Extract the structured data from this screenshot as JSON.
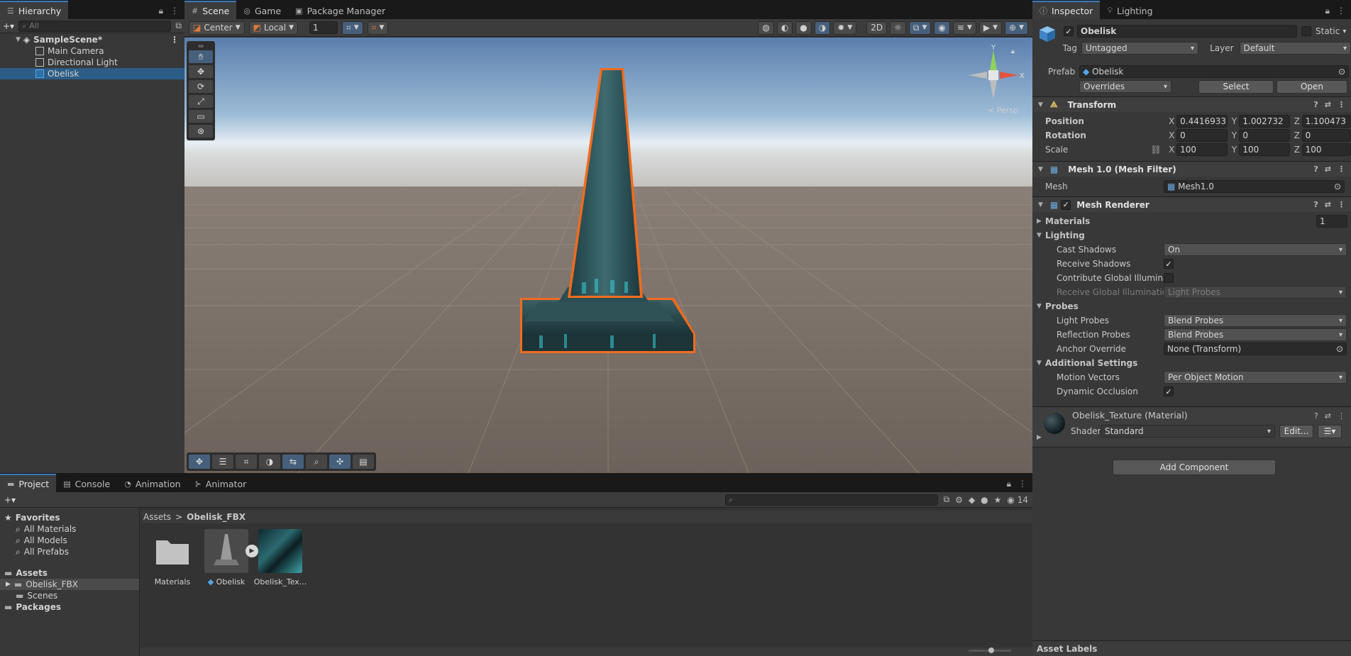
{
  "hierarchy": {
    "tab": "Hierarchy",
    "search_placeholder": "All",
    "scene_name": "SampleScene*",
    "items": [
      "Main Camera",
      "Directional Light",
      "Obelisk"
    ]
  },
  "scene": {
    "tabs": [
      "Scene",
      "Game",
      "Package Manager"
    ],
    "pivot": "Center",
    "space": "Local",
    "snap_value": "1",
    "persp_label": "< Persp",
    "gizmo_axes": {
      "y": "Y",
      "x": "X"
    }
  },
  "project": {
    "tabs": [
      "Project",
      "Console",
      "Animation",
      "Animator"
    ],
    "count": "14",
    "favorites_label": "Favorites",
    "favorites": [
      "All Materials",
      "All Models",
      "All Prefabs"
    ],
    "assets_label": "Assets",
    "assets_children": [
      "Obelisk_FBX",
      "Scenes"
    ],
    "packages_label": "Packages",
    "breadcrumb": [
      "Assets",
      "Obelisk_FBX"
    ],
    "breadcrumb_sep": ">",
    "files": [
      "Materials",
      "Obelisk",
      "Obelisk_Tex..."
    ]
  },
  "inspector": {
    "tabs": [
      "Inspector",
      "Lighting"
    ],
    "object_name": "Obelisk",
    "static_label": "Static",
    "tag_label": "Tag",
    "tag_value": "Untagged",
    "layer_label": "Layer",
    "layer_value": "Default",
    "prefab_label": "Prefab",
    "prefab_value": "Obelisk",
    "overrides": "Overrides",
    "select_label": "Select",
    "open_label": "Open",
    "transform": {
      "title": "Transform",
      "position_label": "Position",
      "rotation_label": "Rotation",
      "scale_label": "Scale",
      "position": {
        "x": "0.4416933",
        "y": "1.002732",
        "z": "1.100473"
      },
      "rotation": {
        "x": "0",
        "y": "0",
        "z": "0"
      },
      "scale": {
        "x": "100",
        "y": "100",
        "z": "100"
      },
      "axis_labels": [
        "X",
        "Y",
        "Z"
      ]
    },
    "mesh_filter": {
      "title": "Mesh 1.0 (Mesh Filter)",
      "mesh_label": "Mesh",
      "mesh_value": "Mesh1.0"
    },
    "mesh_renderer": {
      "title": "Mesh Renderer",
      "materials_label": "Materials",
      "materials_count": "1",
      "lighting_label": "Lighting",
      "cast_shadows_label": "Cast Shadows",
      "cast_shadows_value": "On",
      "receive_shadows_label": "Receive Shadows",
      "contribute_gi_label": "Contribute Global Illuminat",
      "receive_gi_label": "Receive Global Illuminatior",
      "receive_gi_value": "Light Probes",
      "probes_label": "Probes",
      "light_probes_label": "Light Probes",
      "light_probes_value": "Blend Probes",
      "reflection_probes_label": "Reflection Probes",
      "reflection_probes_value": "Blend Probes",
      "anchor_override_label": "Anchor Override",
      "anchor_override_value": "None (Transform)",
      "additional_label": "Additional Settings",
      "motion_vectors_label": "Motion Vectors",
      "motion_vectors_value": "Per Object Motion",
      "dynamic_occlusion_label": "Dynamic Occlusion"
    },
    "material": {
      "name": "Obelisk_Texture (Material)",
      "shader_label": "Shader",
      "shader_value": "Standard",
      "edit_label": "Edit..."
    },
    "add_component": "Add Component",
    "asset_labels": "Asset Labels"
  },
  "colors": {
    "selection": "#2c5d87",
    "accent_blue": "#3a79bb",
    "outline_orange": "#f26b1d",
    "obelisk_teal": "#2a5a60"
  }
}
